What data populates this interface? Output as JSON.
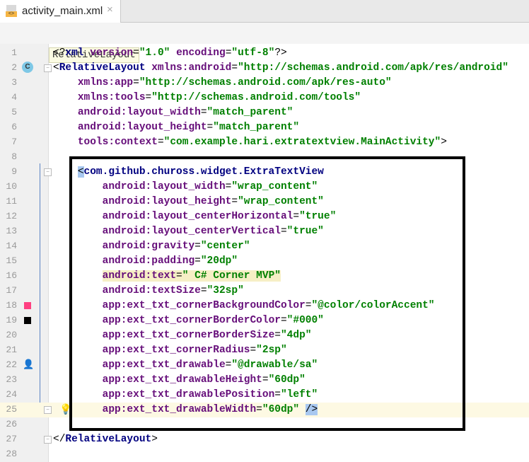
{
  "tab": {
    "title": "activity_main.xml",
    "icon": "xml-file-icon",
    "close": "×"
  },
  "breadcrumb": "RelativeLayout",
  "gutter_badge": "C",
  "colors": {
    "colorAccent": "#ff4081",
    "border": "#000000"
  },
  "lines": [
    [
      [
        "p",
        "<?"
      ],
      [
        "t",
        "xml "
      ],
      [
        "a",
        "version"
      ],
      [
        "p",
        "="
      ],
      [
        "v",
        "\"1.0\" "
      ],
      [
        "a",
        "encoding"
      ],
      [
        "p",
        "="
      ],
      [
        "v",
        "\"utf-8\""
      ],
      [
        "p",
        "?>"
      ]
    ],
    [
      [
        "p",
        "<"
      ],
      [
        "t",
        "RelativeLayout "
      ],
      [
        "a",
        "xmlns:android"
      ],
      [
        "p",
        "="
      ],
      [
        "v",
        "\"http://schemas.android.com/apk/res/android\""
      ]
    ],
    [
      [
        "p",
        "    "
      ],
      [
        "a",
        "xmlns:app"
      ],
      [
        "p",
        "="
      ],
      [
        "v",
        "\"http://schemas.android.com/apk/res-auto\""
      ]
    ],
    [
      [
        "p",
        "    "
      ],
      [
        "a",
        "xmlns:tools"
      ],
      [
        "p",
        "="
      ],
      [
        "v",
        "\"http://schemas.android.com/tools\""
      ]
    ],
    [
      [
        "p",
        "    "
      ],
      [
        "a",
        "android:layout_width"
      ],
      [
        "p",
        "="
      ],
      [
        "v",
        "\"match_parent\""
      ]
    ],
    [
      [
        "p",
        "    "
      ],
      [
        "a",
        "android:layout_height"
      ],
      [
        "p",
        "="
      ],
      [
        "v",
        "\"match_parent\""
      ]
    ],
    [
      [
        "p",
        "    "
      ],
      [
        "a",
        "tools:context"
      ],
      [
        "p",
        "="
      ],
      [
        "v",
        "\"com.example.hari.extratextview.MainActivity\""
      ],
      [
        "p",
        ">"
      ]
    ],
    [],
    [
      [
        "p",
        "    <"
      ],
      [
        "t",
        "com.github.chuross.widget.ExtraTextView"
      ]
    ],
    [
      [
        "p",
        "        "
      ],
      [
        "a",
        "android:layout_width"
      ],
      [
        "p",
        "="
      ],
      [
        "v",
        "\"wrap_content\""
      ]
    ],
    [
      [
        "p",
        "        "
      ],
      [
        "a",
        "android:layout_height"
      ],
      [
        "p",
        "="
      ],
      [
        "v",
        "\"wrap_content\""
      ]
    ],
    [
      [
        "p",
        "        "
      ],
      [
        "a",
        "android:layout_centerHorizontal"
      ],
      [
        "p",
        "="
      ],
      [
        "v",
        "\"true\""
      ]
    ],
    [
      [
        "p",
        "        "
      ],
      [
        "a",
        "android:layout_centerVertical"
      ],
      [
        "p",
        "="
      ],
      [
        "v",
        "\"true\""
      ]
    ],
    [
      [
        "p",
        "        "
      ],
      [
        "a",
        "android:gravity"
      ],
      [
        "p",
        "="
      ],
      [
        "v",
        "\"center\""
      ]
    ],
    [
      [
        "p",
        "        "
      ],
      [
        "a",
        "android:padding"
      ],
      [
        "p",
        "="
      ],
      [
        "v",
        "\"20dp\""
      ]
    ],
    [
      [
        "p",
        "        "
      ],
      [
        "a",
        "android:text"
      ],
      [
        "p",
        "="
      ],
      [
        "v",
        "\" C# Corner MVP\""
      ]
    ],
    [
      [
        "p",
        "        "
      ],
      [
        "a",
        "android:textSize"
      ],
      [
        "p",
        "="
      ],
      [
        "v",
        "\"32sp\""
      ]
    ],
    [
      [
        "p",
        "        "
      ],
      [
        "a",
        "app:ext_txt_cornerBackgroundColor"
      ],
      [
        "p",
        "="
      ],
      [
        "v",
        "\"@color/colorAccent\""
      ]
    ],
    [
      [
        "p",
        "        "
      ],
      [
        "a",
        "app:ext_txt_cornerBorderColor"
      ],
      [
        "p",
        "="
      ],
      [
        "v",
        "\"#000\""
      ]
    ],
    [
      [
        "p",
        "        "
      ],
      [
        "a",
        "app:ext_txt_cornerBorderSize"
      ],
      [
        "p",
        "="
      ],
      [
        "v",
        "\"4dp\""
      ]
    ],
    [
      [
        "p",
        "        "
      ],
      [
        "a",
        "app:ext_txt_cornerRadius"
      ],
      [
        "p",
        "="
      ],
      [
        "v",
        "\"2sp\""
      ]
    ],
    [
      [
        "p",
        "        "
      ],
      [
        "a",
        "app:ext_txt_drawable"
      ],
      [
        "p",
        "="
      ],
      [
        "v",
        "\"@drawable/sa\""
      ]
    ],
    [
      [
        "p",
        "        "
      ],
      [
        "a",
        "app:ext_txt_drawableHeight"
      ],
      [
        "p",
        "="
      ],
      [
        "v",
        "\"60dp\""
      ]
    ],
    [
      [
        "p",
        "        "
      ],
      [
        "a",
        "app:ext_txt_drawablePosition"
      ],
      [
        "p",
        "="
      ],
      [
        "v",
        "\"left\""
      ]
    ],
    [
      [
        "p",
        "        "
      ],
      [
        "a",
        "app:ext_txt_drawableWidth"
      ],
      [
        "p",
        "="
      ],
      [
        "v",
        "\"60dp\" "
      ],
      [
        "p",
        "/>"
      ]
    ],
    [],
    [
      [
        "p",
        "</"
      ],
      [
        "t",
        "RelativeLayout"
      ],
      [
        "p",
        ">"
      ]
    ],
    []
  ]
}
